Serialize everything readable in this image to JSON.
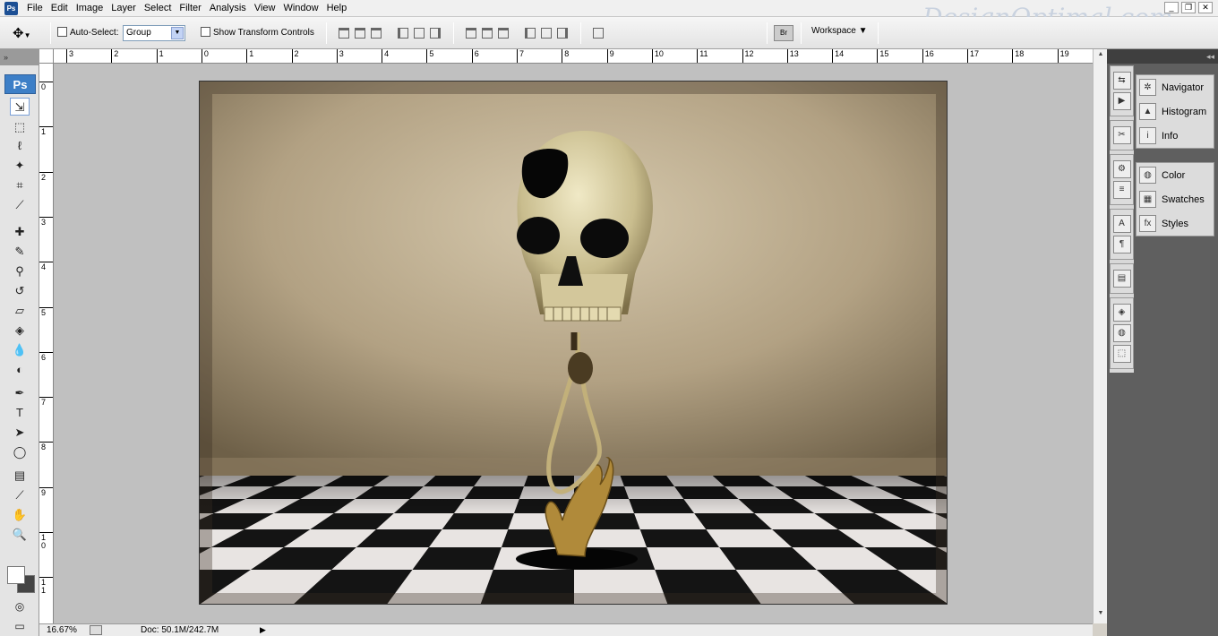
{
  "app": {
    "logo": "Ps"
  },
  "menu": [
    "File",
    "Edit",
    "Image",
    "Layer",
    "Select",
    "Filter",
    "Analysis",
    "View",
    "Window",
    "Help"
  ],
  "watermark": "DesignOptimal.com",
  "window_buttons": [
    "_",
    "❐",
    "✕"
  ],
  "options_bar": {
    "auto_select_label": "Auto-Select:",
    "auto_select_value": "Group",
    "show_transform_label": "Show Transform Controls",
    "workspace_label": "Workspace ▼"
  },
  "toolbox": {
    "badge": "Ps",
    "tools": [
      {
        "name": "move-tool",
        "glyph": "⇲"
      },
      {
        "name": "marquee-tool",
        "glyph": "⬚"
      },
      {
        "name": "lasso-tool",
        "glyph": "ℓ"
      },
      {
        "name": "magic-wand-tool",
        "glyph": "✦"
      },
      {
        "name": "crop-tool",
        "glyph": "⌗"
      },
      {
        "name": "eyedropper-tool",
        "glyph": "⟋"
      },
      {
        "name": "healing-brush-tool",
        "glyph": "✚"
      },
      {
        "name": "brush-tool",
        "glyph": "✎"
      },
      {
        "name": "clone-stamp-tool",
        "glyph": "⚲"
      },
      {
        "name": "history-brush-tool",
        "glyph": "↺"
      },
      {
        "name": "eraser-tool",
        "glyph": "▱"
      },
      {
        "name": "paint-bucket-tool",
        "glyph": "◈"
      },
      {
        "name": "blur-tool",
        "glyph": "💧"
      },
      {
        "name": "dodge-tool",
        "glyph": "◐"
      },
      {
        "name": "pen-tool",
        "glyph": "✒"
      },
      {
        "name": "type-tool",
        "glyph": "T"
      },
      {
        "name": "path-selection-tool",
        "glyph": "➤"
      },
      {
        "name": "ellipse-tool",
        "glyph": "◯"
      },
      {
        "name": "notes-tool",
        "glyph": "▤"
      },
      {
        "name": "color-sampler-tool",
        "glyph": "⟋"
      },
      {
        "name": "hand-tool",
        "glyph": "✋"
      },
      {
        "name": "zoom-tool",
        "glyph": "🔍"
      }
    ]
  },
  "ruler_h": [
    "3",
    "2",
    "1",
    "0",
    "1",
    "2",
    "3",
    "4",
    "5",
    "6",
    "7",
    "8",
    "9",
    "10",
    "11",
    "12",
    "13",
    "14",
    "15",
    "16",
    "17",
    "18",
    "19"
  ],
  "ruler_v": [
    "0",
    "1",
    "2",
    "3",
    "4",
    "5",
    "6",
    "7",
    "8",
    "9",
    "1\n0",
    "1\n1"
  ],
  "status": {
    "zoom": "16.67%",
    "doc": "Doc: 50.1M/242.7M",
    "arrow": "▶"
  },
  "panel_icons": {
    "group1": [
      "⇆",
      "▶"
    ],
    "group2": [
      "✂"
    ],
    "group3": [
      "⚙",
      "≡"
    ],
    "group4": [
      "A",
      "¶"
    ],
    "group5": [
      "▤"
    ],
    "group6": [
      "◈",
      "◍",
      "⬚"
    ]
  },
  "panels": [
    {
      "items": [
        {
          "icon": "✲",
          "label": "Navigator"
        },
        {
          "icon": "▲",
          "label": "Histogram"
        },
        {
          "icon": "i",
          "label": "Info"
        }
      ]
    },
    {
      "items": [
        {
          "icon": "◍",
          "label": "Color"
        },
        {
          "icon": "▦",
          "label": "Swatches"
        },
        {
          "icon": "fx",
          "label": "Styles"
        }
      ]
    }
  ]
}
